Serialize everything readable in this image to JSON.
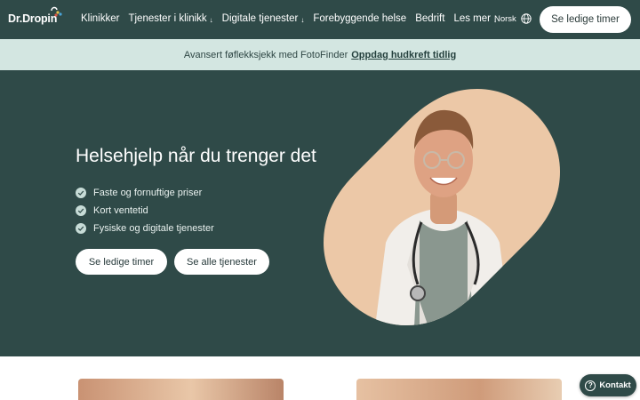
{
  "nav": {
    "logo": "Dr.Dropin",
    "links": [
      {
        "label": "Klinikker",
        "caret": ""
      },
      {
        "label": "Tjenester i klinikk",
        "caret": "↓"
      },
      {
        "label": "Digitale tjenester",
        "caret": "↓"
      },
      {
        "label": "Forebyggende helse",
        "caret": ""
      },
      {
        "label": "Bedrift",
        "caret": ""
      },
      {
        "label": "Les mer",
        "caret": "↓"
      }
    ],
    "language": "Norsk",
    "cta": "Se ledige timer"
  },
  "banner": {
    "text": "Avansert føflekksjekk med FotoFinder",
    "link": "Oppdag hudkreft tidlig"
  },
  "hero": {
    "title": "Helsehjelp når du trenger det",
    "features": [
      "Faste og fornuftige priser",
      "Kort ventetid",
      "Fysiske og digitale tjenester"
    ],
    "primary_button": "Se ledige timer",
    "secondary_button": "Se alle tjenester",
    "image_icon": "doctor-portrait"
  },
  "contact": {
    "label": "Kontakt",
    "icon": "question-icon"
  },
  "colors": {
    "brand_dark": "#2f4a48",
    "banner_bg": "#d3e6e1",
    "peach": "#ecc8a7"
  }
}
